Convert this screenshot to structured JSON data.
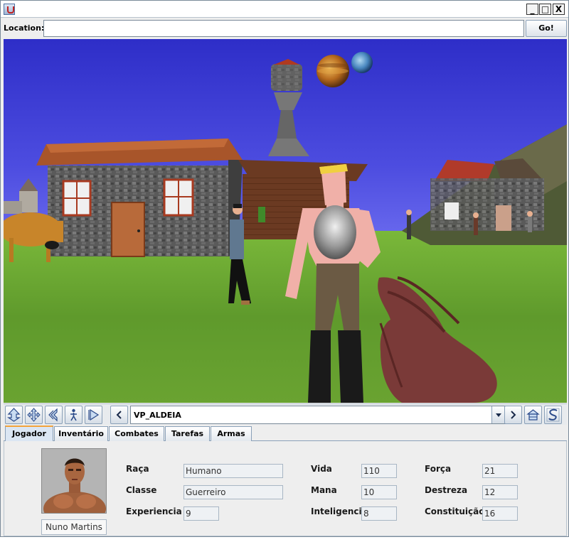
{
  "window": {
    "title": "",
    "buttons": {
      "minimize": "_",
      "maximize": "□",
      "close": "X"
    }
  },
  "location": {
    "label": "Location:",
    "value": "",
    "go_label": "Go!"
  },
  "navigation": {
    "viewpoint": "VP_ALDEIA"
  },
  "tabs": [
    {
      "label": "Jogador",
      "active": true
    },
    {
      "label": "Inventário",
      "active": false
    },
    {
      "label": "Combates",
      "active": false
    },
    {
      "label": "Tarefas",
      "active": false
    },
    {
      "label": "Armas",
      "active": false
    }
  ],
  "player": {
    "name": "Nuno Martins",
    "stats": {
      "raca": {
        "label": "Raça",
        "value": "Humano"
      },
      "classe": {
        "label": "Classe",
        "value": "Guerreiro"
      },
      "experiencia": {
        "label": "Experiencia",
        "value": "9"
      },
      "vida": {
        "label": "Vida",
        "value": "110"
      },
      "mana": {
        "label": "Mana",
        "value": "10"
      },
      "inteligencia": {
        "label": "Inteligencia",
        "value": "8"
      },
      "forca": {
        "label": "Força",
        "value": "21"
      },
      "destreza": {
        "label": "Destreza",
        "value": "12"
      },
      "constituicao": {
        "label": "Constituição",
        "value": "16"
      }
    }
  },
  "icons": {
    "nav_buttons": [
      "walk-up-icon",
      "pan-icon",
      "turn-icon",
      "figure-icon",
      "play-icon",
      "previous-viewpoint-icon",
      "dropdown-arrow-icon",
      "next-viewpoint-icon",
      "home-icon",
      "settings-icon"
    ]
  },
  "colors": {
    "sky": "#3c3cd6",
    "grass": "#6aa331",
    "active_tab_accent": "#f2a33a",
    "panel_bg": "#eeeeee"
  }
}
